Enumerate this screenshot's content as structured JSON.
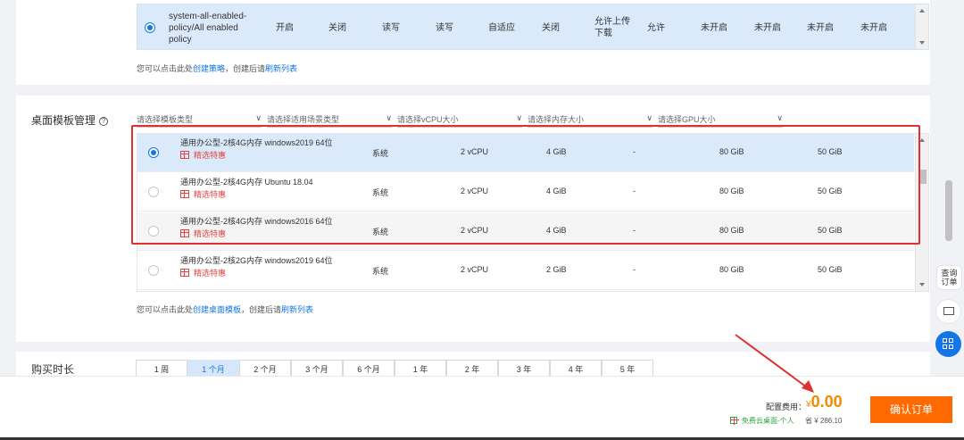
{
  "policy": {
    "row": {
      "name_lines": [
        "system-all-enabled-",
        "policy/All enabled",
        "policy"
      ],
      "cols": [
        "开启",
        "关闭",
        "读写",
        "读写",
        "自适应",
        "关闭"
      ],
      "upload_lines": [
        "允许上传",
        "下载"
      ],
      "cols2": [
        "允许",
        "未开启",
        "未开启",
        "未开启",
        "未开启"
      ]
    },
    "hint": {
      "pre": "您可以点击此处",
      "link1": "创建策略",
      "mid": "，创建后请",
      "link2": "刷新列表"
    }
  },
  "template": {
    "section_label": "桌面模板管理",
    "help_icon": "?",
    "filters": [
      {
        "placeholder": "请选择模板类型",
        "chev": "∨"
      },
      {
        "placeholder": "请选择适用场景类型",
        "chev": "∨"
      },
      {
        "placeholder": "请选择vCPU大小",
        "chev": "∨"
      },
      {
        "placeholder": "请选择内存大小",
        "chev": "∨"
      },
      {
        "placeholder": "请选择GPU大小",
        "chev": "∨"
      }
    ],
    "rows": [
      {
        "name": "通用办公型-2核4G内存 windows2019 64位",
        "promo": "精选特惠",
        "type": "系统",
        "vcpu": "2 vCPU",
        "mem": "4 GiB",
        "gpu": "-",
        "sys": "80 GiB",
        "data": "50 GiB"
      },
      {
        "name": "通用办公型-2核4G内存 Ubuntu 18.04",
        "promo": "精选特惠",
        "type": "系统",
        "vcpu": "2 vCPU",
        "mem": "4 GiB",
        "gpu": "-",
        "sys": "80 GiB",
        "data": "50 GiB"
      },
      {
        "name": "通用办公型-2核4G内存 windows2016 64位",
        "promo": "精选特惠",
        "type": "系统",
        "vcpu": "2 vCPU",
        "mem": "4 GiB",
        "gpu": "-",
        "sys": "80 GiB",
        "data": "50 GiB"
      },
      {
        "name": "通用办公型-2核2G内存 windows2019 64位",
        "promo": "精选特惠",
        "type": "系统",
        "vcpu": "2 vCPU",
        "mem": "2 GiB",
        "gpu": "-",
        "sys": "80 GiB",
        "data": "50 GiB"
      }
    ],
    "hint": {
      "pre": "您可以点击此处",
      "link1": "创建桌面模板",
      "mid": "，创建后请",
      "link2": "刷新列表"
    }
  },
  "duration": {
    "label": "购买时长",
    "options": [
      "1 周",
      "1 个月",
      "2 个月",
      "3 个月",
      "6 个月",
      "1 年",
      "2 年",
      "3 年",
      "4 年",
      "5 年"
    ],
    "selected": "1 个月"
  },
  "footer": {
    "fee_label": "配置费用：",
    "currency": "¥",
    "fee": "0.00",
    "free_note": "免费云桌面-个人",
    "save_note": "省 ¥ 286.10",
    "confirm": "确认订单"
  },
  "float": {
    "order_line1": "查询",
    "order_line2": "订单"
  },
  "colors": {
    "accent": "#1476e6",
    "price": "#f28a00",
    "button": "#ff6a00",
    "highlight": "#e03030"
  }
}
